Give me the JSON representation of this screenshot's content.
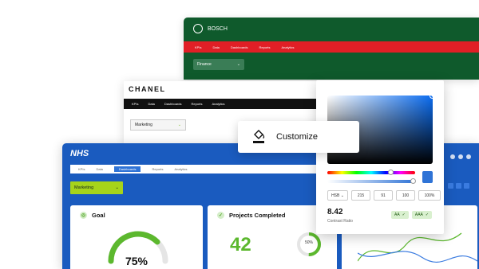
{
  "bosch": {
    "brand": "BOSCH",
    "nav": [
      "KPIs",
      "Data",
      "Dashboards",
      "Reports",
      "Analytics"
    ],
    "select": "Finance"
  },
  "chanel": {
    "brand": "CHANEL",
    "nav": [
      "KPIs",
      "Data",
      "Dashboards",
      "Reports",
      "Analytics"
    ],
    "select": "Marketing"
  },
  "nhs": {
    "brand": "NHS",
    "tabs": [
      "KPIs",
      "Data",
      "Dashboards",
      "Reports",
      "Analytics"
    ],
    "active_tab": 2,
    "select": "Marketing",
    "cards": {
      "goal": {
        "title": "Goal",
        "value": "75%",
        "progress": 0.75
      },
      "projects": {
        "title": "Projects Completed",
        "value": "42",
        "ring_label": "50%",
        "ring_progress": 0.5
      }
    }
  },
  "customize": {
    "label": "Customize"
  },
  "picker": {
    "mode": "HSB",
    "fields": [
      "215",
      "91",
      "100",
      "100%"
    ],
    "contrast_value": "8.42",
    "contrast_label": "Contrast Ratio",
    "badges": [
      "AA",
      "AAA"
    ],
    "color": "#2f73d6"
  },
  "colors": {
    "bosch_green": "#0f5a2c",
    "bosch_red": "#e11f26",
    "nhs_blue": "#1a5bbf",
    "accent_green": "#a6d41a"
  }
}
